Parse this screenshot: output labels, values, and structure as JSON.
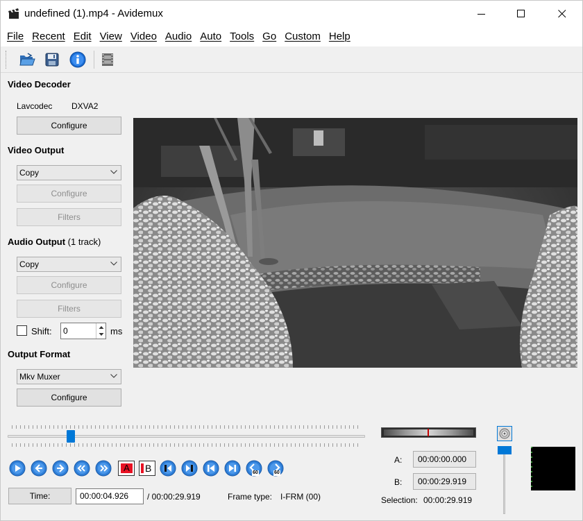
{
  "window": {
    "title": "undefined (1).mp4 - Avidemux"
  },
  "menu": [
    "File",
    "Recent",
    "Edit",
    "View",
    "Video",
    "Audio",
    "Auto",
    "Tools",
    "Go",
    "Custom",
    "Help"
  ],
  "toolbar": {
    "icons": [
      "open-folder-icon",
      "save-disk-icon",
      "info-icon",
      "film-strip-icon"
    ]
  },
  "video_decoder": {
    "title": "Video Decoder",
    "decoder": "Lavcodec",
    "hw": "DXVA2",
    "configure_label": "Configure"
  },
  "video_output": {
    "title": "Video Output",
    "selected": "Copy",
    "configure_label": "Configure",
    "filters_label": "Filters"
  },
  "audio_output": {
    "title": "Audio Output",
    "track_info": "(1 track)",
    "selected": "Copy",
    "configure_label": "Configure",
    "filters_label": "Filters",
    "shift_label": "Shift:",
    "shift_value": "0",
    "shift_unit": "ms"
  },
  "output_format": {
    "title": "Output Format",
    "selected": "Mkv Muxer",
    "configure_label": "Configure"
  },
  "timeline": {
    "position_fraction": 0.168
  },
  "nav_buttons": [
    "play-icon",
    "previous-frame-icon",
    "next-frame-icon",
    "previous-keyframe-icon",
    "next-keyframe-icon",
    "set-marker-a-icon",
    "set-marker-b-icon",
    "previous-cut-icon",
    "next-cut-icon",
    "go-to-first-frame-icon",
    "go-to-last-frame-icon",
    "back-60s-icon",
    "forward-60s-icon"
  ],
  "nav_labels": {
    "marker_a": "A",
    "marker_b": "B",
    "sixty": "60"
  },
  "status": {
    "time_button": "Time:",
    "current_time": "00:00:04.926",
    "total_time": "/ 00:00:29.919",
    "frame_type_label": "Frame type:",
    "frame_type": "I-FRM (00)"
  },
  "markers": {
    "a_label": "A:",
    "a_value": "00:00:00.000",
    "b_label": "B:",
    "b_value": "00:00:29.919",
    "selection_label": "Selection:",
    "selection_value": "00:00:29.919"
  },
  "colors": {
    "accent": "#0078d7",
    "marker_red": "#e81123"
  }
}
